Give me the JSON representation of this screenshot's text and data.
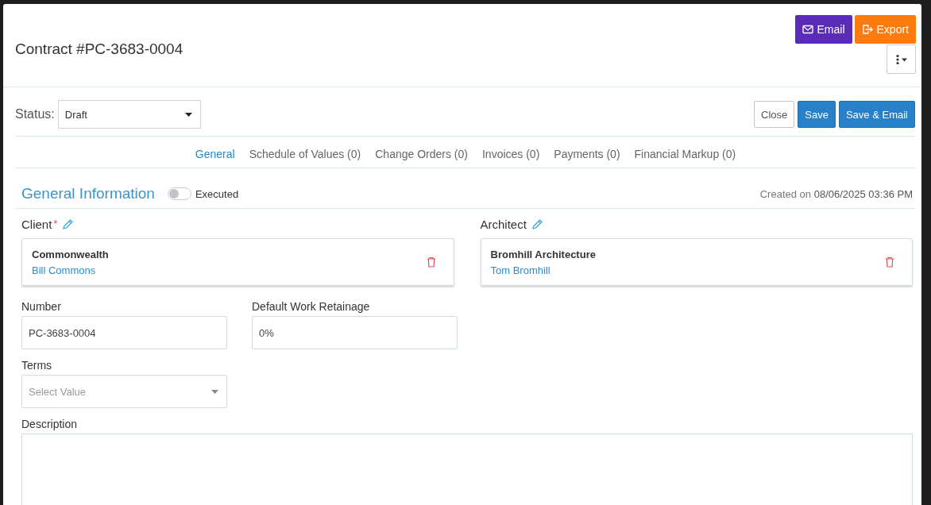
{
  "title": "Contract #PC-3683-0004",
  "header_buttons": [
    {
      "label": "Email",
      "kind": "email"
    },
    {
      "label": "Export",
      "kind": "export"
    }
  ],
  "status": {
    "label": "Status:",
    "value": "Draft"
  },
  "action_buttons": [
    {
      "label": "Close",
      "kind": "close"
    },
    {
      "label": "Save",
      "kind": "primary"
    },
    {
      "label": "Save & Email",
      "kind": "primary"
    }
  ],
  "tabs": [
    {
      "label": "General",
      "selected": true
    },
    {
      "label": "Schedule of Values (0)",
      "selected": false
    },
    {
      "label": "Change Orders (0)",
      "selected": false
    },
    {
      "label": "Invoices (0)",
      "selected": false
    },
    {
      "label": "Payments (0)",
      "selected": false
    },
    {
      "label": "Financial Markup (0)",
      "selected": false
    }
  ],
  "section": {
    "title": "General Information",
    "toggle_label": "Executed",
    "executed": false,
    "created_label": "Created on",
    "created_value": "08/06/2025 03:36 PM"
  },
  "parties": [
    {
      "label": "Client",
      "required_mark": "*",
      "company": "Commonwealth",
      "contact": "Bill Commons"
    },
    {
      "label": "Architect",
      "company": "Bromhill Architecture",
      "contact": "Tom Bromhill"
    }
  ],
  "fields": [
    {
      "label": "Number",
      "kind": "text",
      "value": "PC-3683-0004"
    },
    {
      "label": "Default Work Retainage",
      "kind": "text",
      "value": "0%"
    },
    {
      "label": "Terms",
      "kind": "select",
      "placeholder": "Select Value"
    }
  ],
  "description": {
    "label": "Description"
  }
}
